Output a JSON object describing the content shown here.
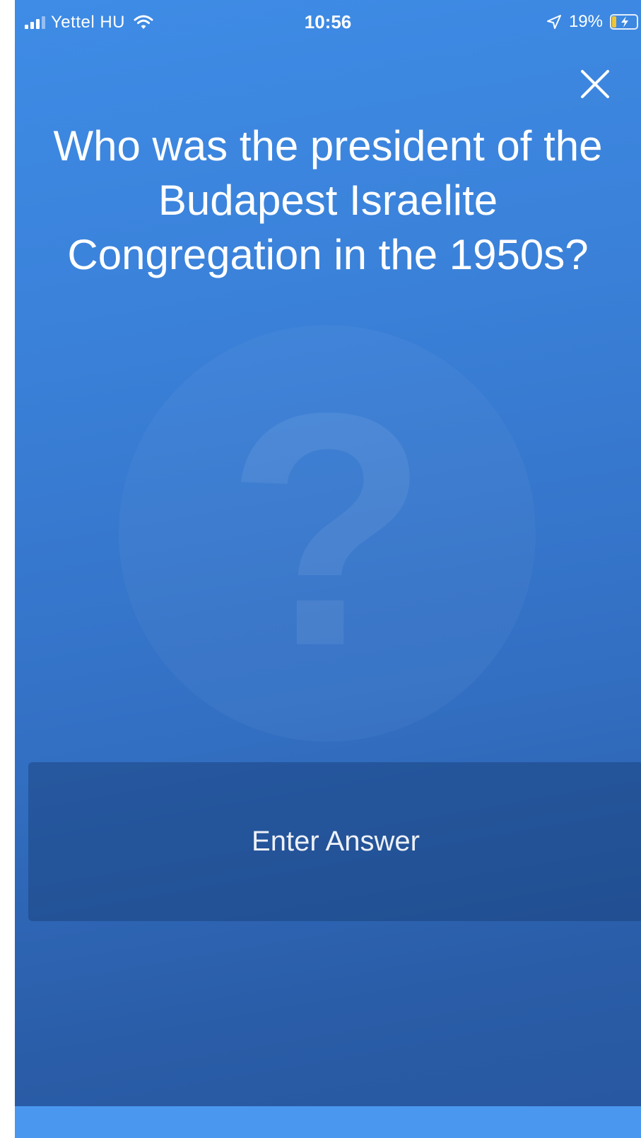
{
  "status_bar": {
    "carrier": "Yettel HU",
    "time": "10:56",
    "battery_percent": "19%",
    "battery_level": 0.19,
    "battery_color": "#f2c531",
    "icons": [
      "signal-icon",
      "wifi-icon",
      "location-arrow-icon",
      "battery-charging-icon"
    ]
  },
  "close_icon": "close-icon",
  "question": {
    "text": "Who was the president of the Budapest Israelite Congregation in the 1950s?",
    "watermark_glyph": "?"
  },
  "answer": {
    "placeholder": "Enter Answer",
    "value": ""
  },
  "colors": {
    "background_top": "#3e8ce6",
    "background_bottom": "#27579f",
    "bottom_bar": "#4a97ef"
  }
}
